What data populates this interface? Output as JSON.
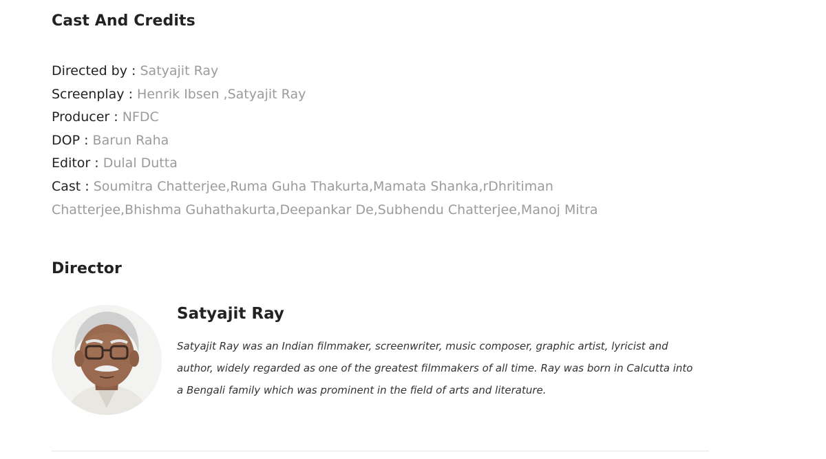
{
  "cast_and_credits": {
    "title": "Cast And Credits",
    "rows": [
      {
        "label": "Directed by :",
        "value": "Satyajit Ray"
      },
      {
        "label": "Screenplay :",
        "value": "Henrik Ibsen ,Satyajit Ray"
      },
      {
        "label": "Producer :",
        "value": "NFDC"
      },
      {
        "label": "DOP :",
        "value": "Barun Raha"
      },
      {
        "label": "Editor :",
        "value": "Dulal Dutta"
      },
      {
        "label": "Cast :",
        "value": "Soumitra Chatterjee,Ruma Guha Thakurta,Mamata Shanka,rDhritiman Chatterjee,Bhishma Guhathakurta,Deepankar De,Subhendu Chatterjee,Manoj Mitra"
      }
    ]
  },
  "director": {
    "title": "Director",
    "name": "Satyajit Ray",
    "bio": "Satyajit Ray was an Indian filmmaker, screenwriter, music composer, graphic artist, lyricist and author, widely regarded as one of the greatest filmmakers of all time. Ray was born in Calcutta into a Bengali family which was prominent in the field of arts and literature.",
    "photo": "director-portrait"
  },
  "colors": {
    "label": "#222222",
    "value": "#9b9b9b",
    "divider": "#e6e6e6"
  }
}
